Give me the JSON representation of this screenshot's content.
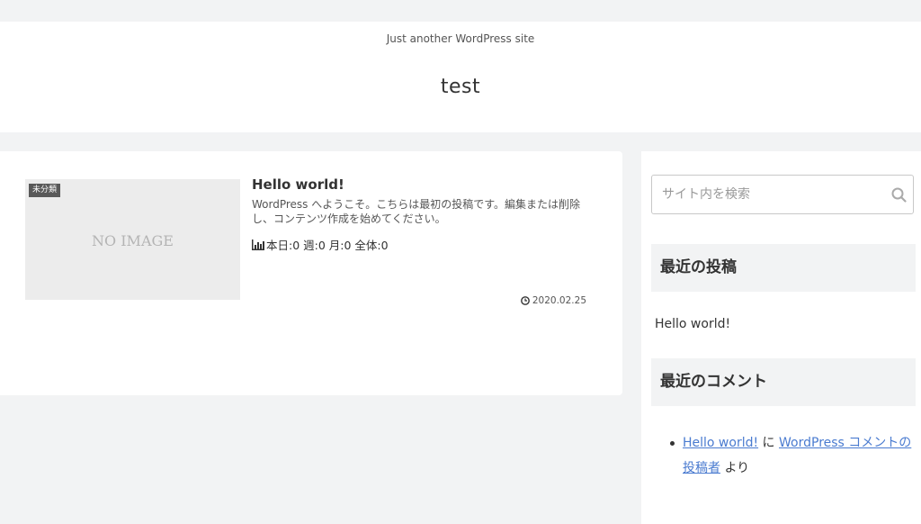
{
  "header": {
    "tagline": "Just another WordPress site",
    "site_title": "test"
  },
  "post": {
    "category": "未分類",
    "no_image_text": "NO IMAGE",
    "title": "Hello world!",
    "excerpt": "WordPress へようこそ。こちらは最初の投稿です。編集または削除し、コンテンツ作成を始めてください。",
    "stats": "本日:0 週:0 月:0 全体:0",
    "date": "2020.02.25"
  },
  "sidebar": {
    "search_placeholder": "サイト内を検索",
    "recent_posts_heading": "最近の投稿",
    "recent_posts": [
      "Hello world!"
    ],
    "recent_comments_heading": "最近のコメント",
    "recent_comment": {
      "post_link": "Hello world!",
      "joiner": " に ",
      "author_link": "WordPress コメントの投稿者",
      "suffix": " より"
    }
  },
  "colors": {
    "page_bg": "#f2f3f4",
    "link": "#4a7bd0",
    "badge_bg": "#595959"
  },
  "icons": {
    "search": "search-icon",
    "stats": "bar-chart-icon",
    "date": "clock-icon"
  }
}
